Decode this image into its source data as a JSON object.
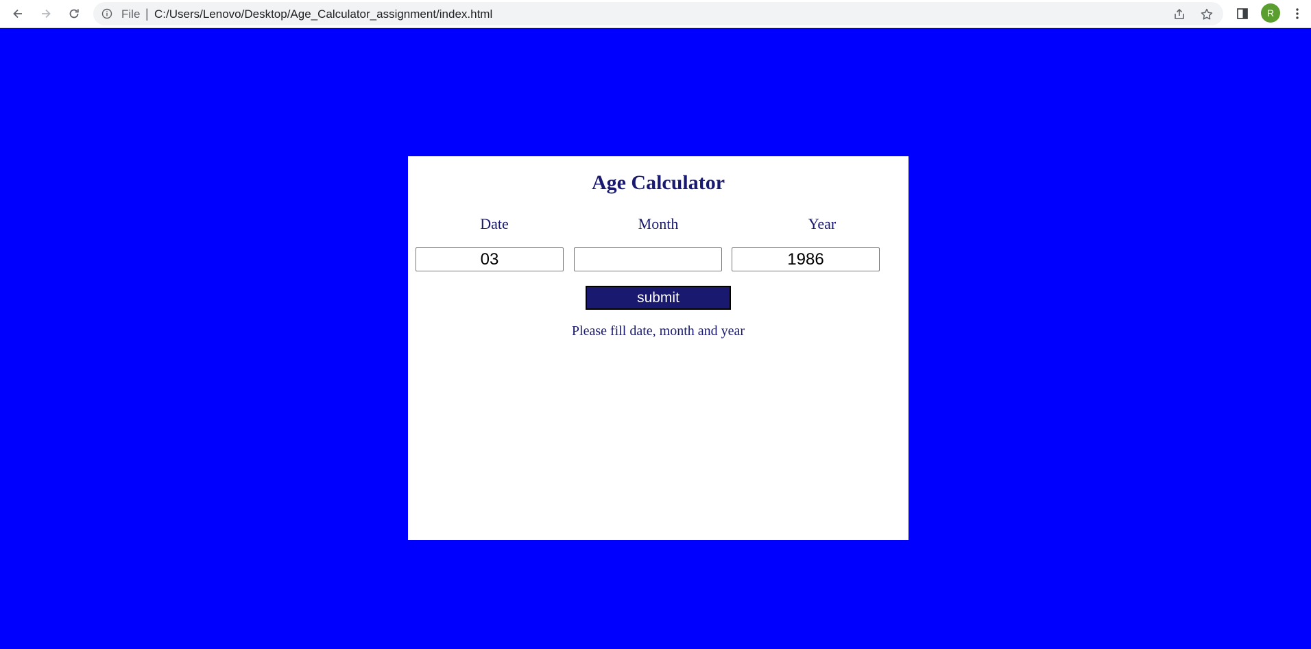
{
  "browser": {
    "scheme_label": "File",
    "url": "C:/Users/Lenovo/Desktop/Age_Calculator_assignment/index.html",
    "profile_initial": "R",
    "profile_color": "#5a9e2f"
  },
  "page": {
    "background_color": "#0000ff",
    "accent_color": "#191970",
    "title": "Age Calculator",
    "fields": [
      {
        "label": "Date",
        "value": "03"
      },
      {
        "label": "Month",
        "value": ""
      },
      {
        "label": "Year",
        "value": "1986"
      }
    ],
    "submit_label": "submit",
    "message": "Please fill date, month and year"
  }
}
